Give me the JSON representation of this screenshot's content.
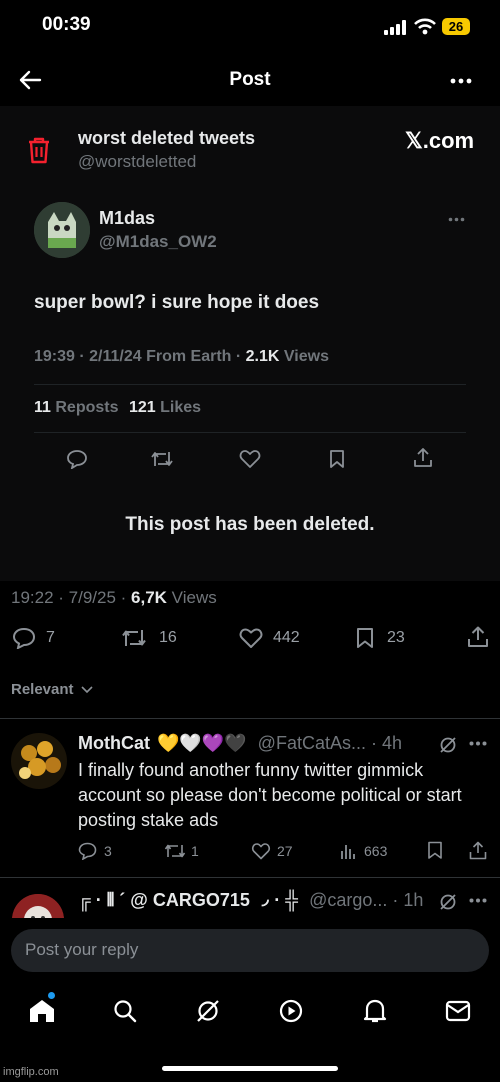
{
  "status_bar": {
    "time": "00:39",
    "battery": "26"
  },
  "header": {
    "title": "Post"
  },
  "screenshot_card": {
    "account_name": "worst deleted tweets",
    "account_handle": "@worstdeletted",
    "watermark": "𝕏.com",
    "tweet": {
      "author_name": "M1das",
      "author_handle": "@M1das_OW2",
      "text": "super bowl? i sure hope it does",
      "meta_prefix": "19:39 · 2/11/24 From Earth · ",
      "views_count": "2.1K",
      "views_label": " Views",
      "reposts_count": "11",
      "reposts_label": " Reposts",
      "likes_count": "121",
      "likes_label": " Likes"
    },
    "deleted_notice": "This post has been deleted."
  },
  "post_meta": {
    "prefix": "19:22 · 7/9/25 · ",
    "views_count": "6,7K",
    "views_label": " Views"
  },
  "post_actions": {
    "replies": "7",
    "reposts": "16",
    "likes": "442",
    "bookmarks": "23"
  },
  "sort": {
    "label": "Relevant"
  },
  "replies": [
    {
      "name": "MothCat",
      "emojis": "💛🤍💜🖤",
      "handle": "@FatCatAs...",
      "time": "· 4h",
      "text": "I finally found another funny twitter gimmick account so please don't become political or start posting stake ads",
      "replies": "3",
      "reposts": "1",
      "likes": "27",
      "views": "663"
    },
    {
      "name": "╔ · ⫴ ´ @ CARGO715 ◞ · ╬",
      "handle": "@cargo...",
      "time": "· 1h"
    }
  ],
  "composer": {
    "placeholder": "Post your reply"
  },
  "watermark_footer": "imgflip.com",
  "colors": {
    "bg": "#000000",
    "accent": "#1d9bf0",
    "danger": "#f4212e"
  }
}
